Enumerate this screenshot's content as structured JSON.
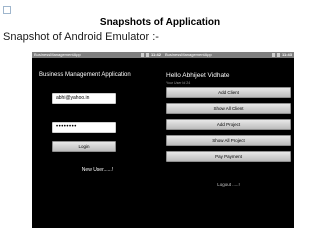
{
  "slide": {
    "title": "Snapshots of Application",
    "subtitle": "Snapshot of Android Emulator :-"
  },
  "left_phone": {
    "statusbar_app": "BusinessManagementApp",
    "statusbar_time": "11:42",
    "header": "Business Management Application",
    "email_value": "abhi@yahoo.in",
    "password_mask": "••••••••",
    "login_label": "Login",
    "new_user_label": "New User......!"
  },
  "right_phone": {
    "statusbar_app": "BusinessManagementApp",
    "statusbar_time": "11:43",
    "greeting": "Hello Abhijeet Vidhate",
    "user_id": "Your User Id 24",
    "buttons": [
      "Add Client",
      "Show All Client",
      "Add Project",
      "Show All Project",
      "Pay Payment"
    ],
    "logout_label": "Logout .....!"
  }
}
